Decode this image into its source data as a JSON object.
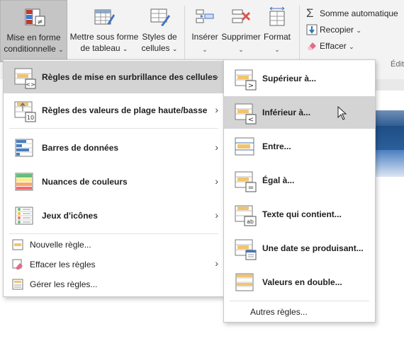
{
  "ribbon": {
    "cond_format": {
      "line1": "Mise en forme",
      "line2": "conditionnelle"
    },
    "format_table": {
      "line1": "Mettre sous forme",
      "line2": "de tableau"
    },
    "cell_styles": {
      "line1": "Styles de",
      "line2": "cellules"
    },
    "insert": "Insérer",
    "delete": "Supprimer",
    "format": "Format",
    "autosum": "Somme automatique",
    "fill": "Recopier",
    "clear": "Effacer",
    "group_edit": "Édit"
  },
  "main_menu": {
    "items": [
      {
        "label": "Règles de mise en surbrillance des cellules",
        "icon": "highlight-rules-icon"
      },
      {
        "label": "Règles des valeurs de plage haute/basse",
        "icon": "top-bottom-rules-icon"
      },
      {
        "label": "Barres de données",
        "icon": "data-bars-icon"
      },
      {
        "label": "Nuances de couleurs",
        "icon": "color-scales-icon"
      },
      {
        "label": "Jeux d'icônes",
        "icon": "icon-sets-icon"
      }
    ],
    "small_items": [
      {
        "label": "Nouvelle règle...",
        "icon": "new-rule-icon"
      },
      {
        "label": "Effacer les règles",
        "icon": "clear-rules-icon"
      },
      {
        "label": "Gérer les règles...",
        "icon": "manage-rules-icon"
      }
    ]
  },
  "sub_menu": {
    "items": [
      {
        "label": "Supérieur à...",
        "icon": "greater-than-icon",
        "symbol": ">"
      },
      {
        "label": "Inférieur à...",
        "icon": "less-than-icon",
        "symbol": "<"
      },
      {
        "label": "Entre...",
        "icon": "between-icon",
        "symbol": ""
      },
      {
        "label": "Égal à...",
        "icon": "equal-to-icon",
        "symbol": "="
      },
      {
        "label": "Texte qui contient...",
        "icon": "text-contains-icon",
        "symbol": "ab"
      },
      {
        "label": "Une date se produisant...",
        "icon": "date-occurring-icon",
        "symbol": ""
      },
      {
        "label": "Valeurs en double...",
        "icon": "duplicate-values-icon",
        "symbol": ""
      }
    ],
    "more": "Autres règles..."
  },
  "colors": {
    "highlight": "#d4d4d4",
    "accent_blue": "#2e75b6",
    "ribbon_bg": "#f3f3f3"
  }
}
